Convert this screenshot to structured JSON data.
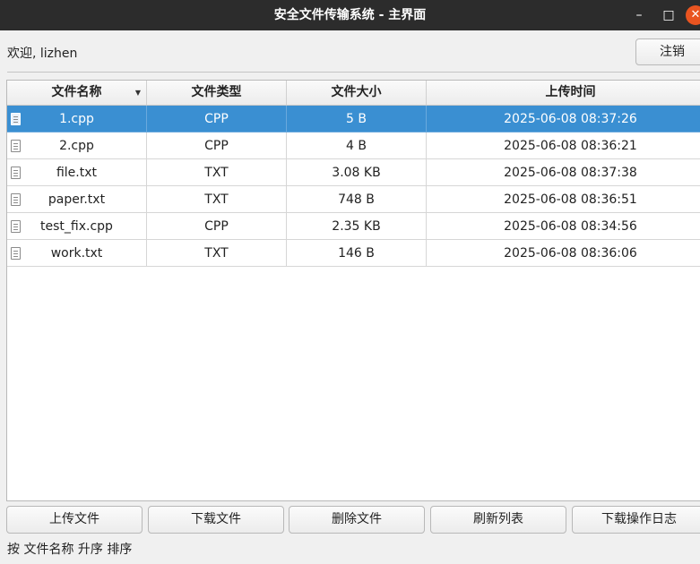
{
  "window": {
    "title": "安全文件传输系统 - 主界面",
    "minimize_glyph": "–",
    "maximize_glyph": "□",
    "close_glyph": "✕"
  },
  "header": {
    "welcome": "欢迎, lizhen",
    "logout_label": "注销"
  },
  "table": {
    "columns": [
      "文件名称",
      "文件类型",
      "文件大小",
      "上传时间"
    ],
    "sort_indicator": "▼",
    "rows": [
      {
        "name": "1.cpp",
        "type": "CPP",
        "size": "5 B",
        "time": "2025-06-08 08:37:26",
        "selected": true
      },
      {
        "name": "2.cpp",
        "type": "CPP",
        "size": "4 B",
        "time": "2025-06-08 08:36:21"
      },
      {
        "name": "file.txt",
        "type": "TXT",
        "size": "3.08 KB",
        "time": "2025-06-08 08:37:38"
      },
      {
        "name": "paper.txt",
        "type": "TXT",
        "size": "748 B",
        "time": "2025-06-08 08:36:51"
      },
      {
        "name": "test_fix.cpp",
        "type": "CPP",
        "size": "2.35 KB",
        "time": "2025-06-08 08:34:56"
      },
      {
        "name": "work.txt",
        "type": "TXT",
        "size": "146 B",
        "time": "2025-06-08 08:36:06"
      }
    ]
  },
  "actions": {
    "upload": "上传文件",
    "download": "下载文件",
    "delete": "删除文件",
    "refresh": "刷新列表",
    "download_log": "下载操作日志"
  },
  "status": "按 文件名称 升序 排序",
  "colors": {
    "titlebar": "#2c2c2c",
    "selection": "#3a8fd2",
    "close_button": "#e95420"
  },
  "icons": [
    "document-icon",
    "sort-down-icon"
  ]
}
